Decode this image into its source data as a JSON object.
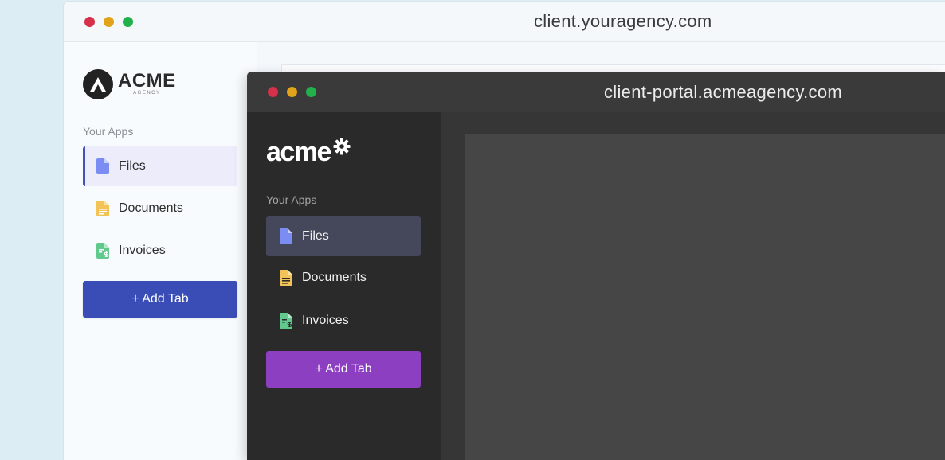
{
  "colors": {
    "dot_red": "#d6304a",
    "dot_yellow": "#e0a31a",
    "dot_green": "#22b04a",
    "light_accent": "#3a4db6",
    "dark_accent": "#8c3fc0",
    "files_icon": "#7b8cf2",
    "documents_icon": "#f2c356",
    "invoices_icon": "#62c98e"
  },
  "back_window": {
    "url": "client.youragency.com",
    "logo": {
      "word": "ACME",
      "sub": "AGENCY"
    },
    "section_label": "Your Apps",
    "nav": [
      {
        "label": "Files",
        "icon": "file-icon",
        "active": true
      },
      {
        "label": "Documents",
        "icon": "document-icon",
        "active": false
      },
      {
        "label": "Invoices",
        "icon": "invoice-icon",
        "active": false
      }
    ],
    "add_tab_label": "+ Add Tab"
  },
  "front_window": {
    "url": "client-portal.acmeagency.com",
    "logo": {
      "word": "acme"
    },
    "section_label": "Your Apps",
    "nav": [
      {
        "label": "Files",
        "icon": "file-icon",
        "active": true
      },
      {
        "label": "Documents",
        "icon": "document-icon",
        "active": false
      },
      {
        "label": "Invoices",
        "icon": "invoice-icon",
        "active": false
      }
    ],
    "add_tab_label": "+ Add Tab"
  }
}
